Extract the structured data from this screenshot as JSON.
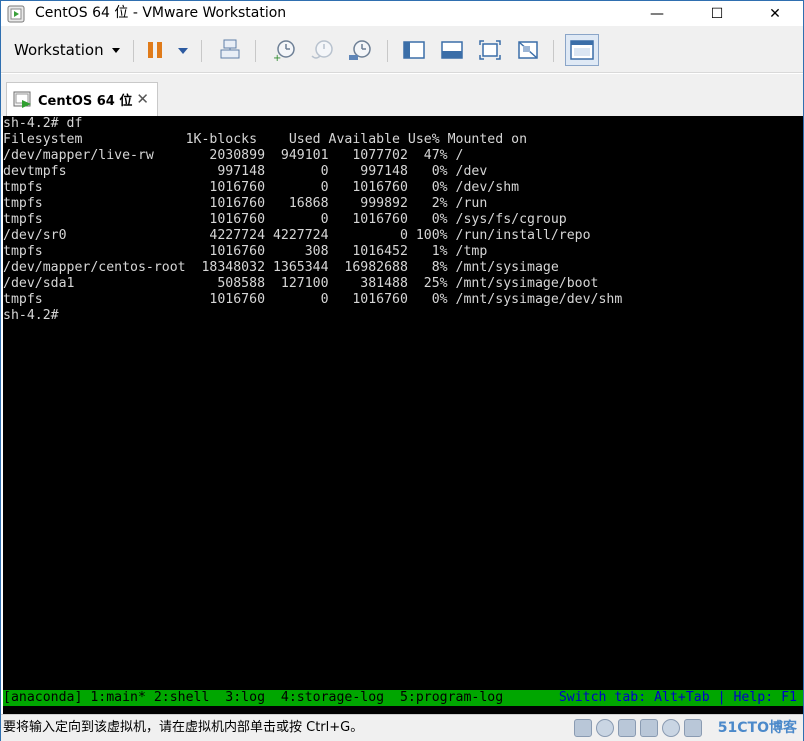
{
  "window": {
    "title": "CentOS 64 位 - VMware Workstation",
    "min_glyph": "—",
    "max_glyph": "☐",
    "close_glyph": "✕"
  },
  "toolbar": {
    "workstation_menu": "Workstation",
    "icons": [
      "pause-icon",
      "send-ctrl-alt-del-icon",
      "take-snapshot-icon",
      "revert-snapshot-icon",
      "snapshot-manager-icon",
      "show-library-icon",
      "quick-switch-icon",
      "full-screen-icon",
      "unity-icon",
      "console-view-icon"
    ]
  },
  "tabs": [
    {
      "label": "CentOS 64 位",
      "close_glyph": "✕",
      "active": true
    }
  ],
  "terminal": {
    "lines": [
      "sh-4.2# df",
      "Filesystem             1K-blocks    Used Available Use% Mounted on",
      "/dev/mapper/live-rw       2030899  949101   1077702  47% /",
      "devtmpfs                   997148       0    997148   0% /dev",
      "tmpfs                     1016760       0   1016760   0% /dev/shm",
      "tmpfs                     1016760   16868    999892   2% /run",
      "tmpfs                     1016760       0   1016760   0% /sys/fs/cgroup",
      "/dev/sr0                  4227724 4227724         0 100% /run/install/repo",
      "tmpfs                     1016760     308   1016452   1% /tmp",
      "/dev/mapper/centos-root  18348032 1365344  16982688   8% /mnt/sysimage",
      "/dev/sda1                  508588  127100    381488  25% /mnt/sysimage/boot",
      "tmpfs                     1016760       0   1016760   0% /mnt/sysimage/dev/shm",
      "sh-4.2#"
    ],
    "anaconda_tabs": "[anaconda] 1:main* 2:shell  3:log  4:storage-log  5:program-log",
    "anaconda_hint": "Switch tab: Alt+Tab | Help: F1"
  },
  "statusbar": {
    "message": "要将输入定向到该虚拟机，请在虚拟机内部单击或按 Ctrl+G。",
    "watermark": "51CTO博客"
  },
  "colors": {
    "console_bg": "#000000",
    "console_fg": "#d6d6d6",
    "anaconda_bar": "#00a600",
    "pause_accent": "#e07b1a"
  }
}
